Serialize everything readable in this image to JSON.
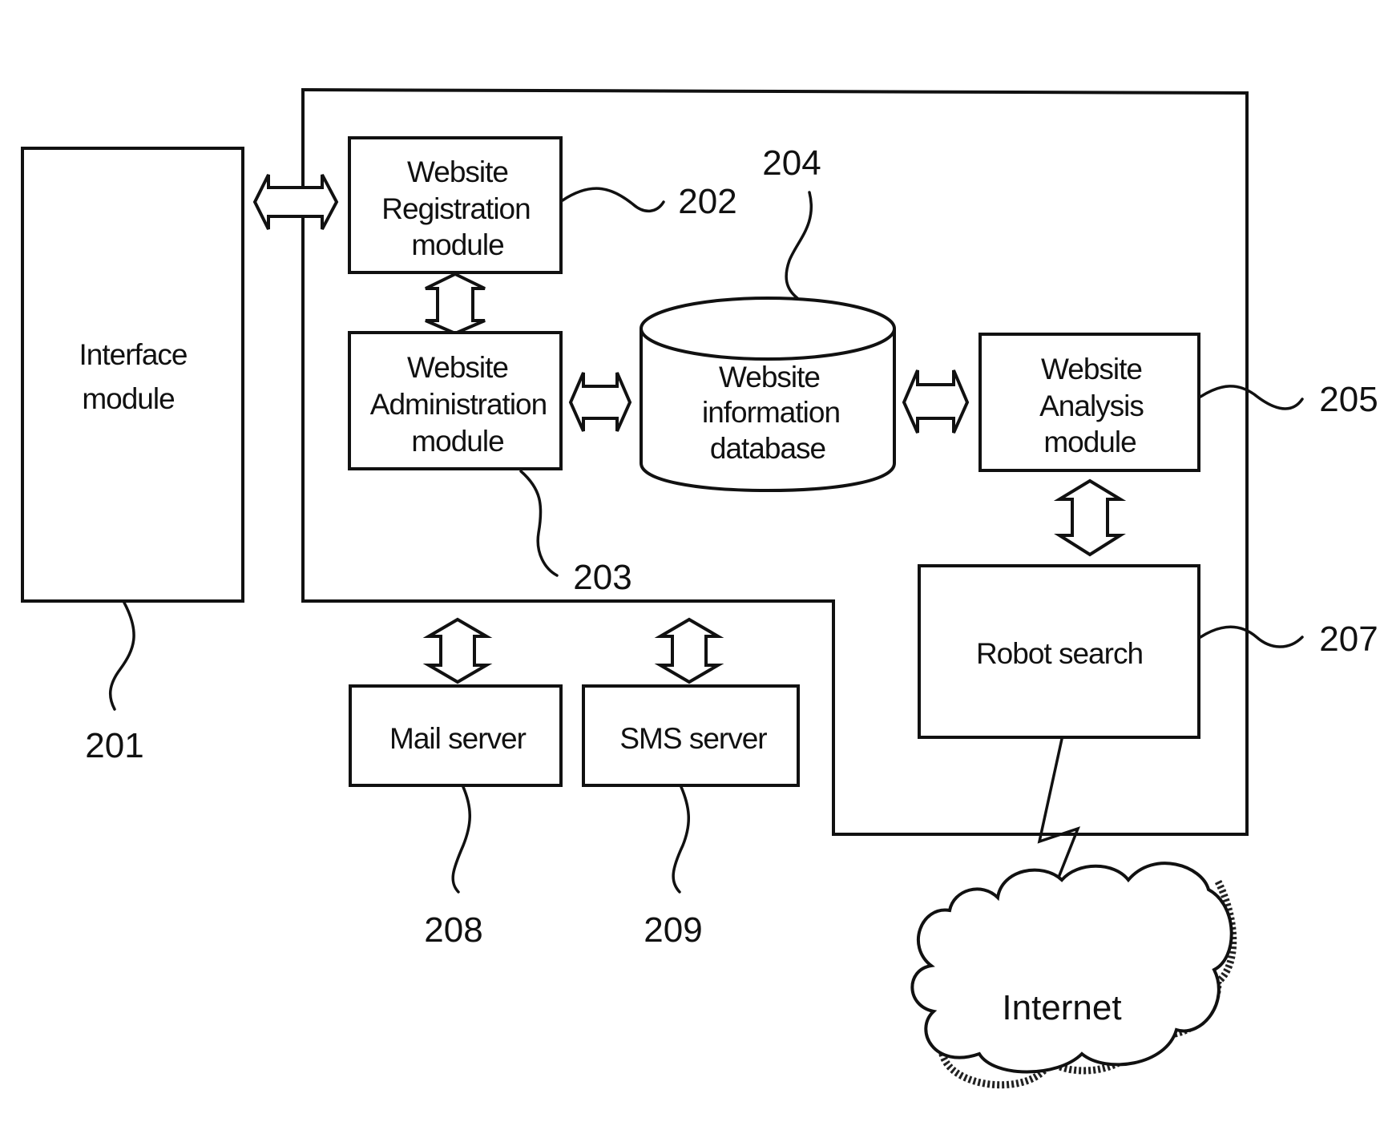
{
  "figure": {
    "nodes": {
      "interface": {
        "lines": [
          "Interface",
          "module"
        ],
        "ref": "201"
      },
      "registration": {
        "lines": [
          "Website",
          "Registration",
          "module"
        ],
        "ref": "202"
      },
      "administration": {
        "lines": [
          "Website",
          "Administration",
          "module"
        ],
        "ref": "203"
      },
      "database": {
        "lines": [
          "Website",
          "information",
          "database"
        ],
        "ref": "204"
      },
      "analysis": {
        "lines": [
          "Website",
          "Analysis",
          "module"
        ],
        "ref": "205"
      },
      "robot": {
        "lines": [
          "Robot search"
        ],
        "ref": "207"
      },
      "mail": {
        "lines": [
          "Mail server"
        ],
        "ref": "208"
      },
      "sms": {
        "lines": [
          "SMS server"
        ],
        "ref": "209"
      },
      "internet": {
        "lines": [
          "Internet"
        ]
      }
    },
    "connections": [
      {
        "from": "interface",
        "to": "registration",
        "type": "bidirectional"
      },
      {
        "from": "registration",
        "to": "administration",
        "type": "bidirectional"
      },
      {
        "from": "administration",
        "to": "database",
        "type": "bidirectional"
      },
      {
        "from": "database",
        "to": "analysis",
        "type": "bidirectional"
      },
      {
        "from": "analysis",
        "to": "robot",
        "type": "bidirectional"
      },
      {
        "from": "system",
        "to": "mail",
        "type": "bidirectional"
      },
      {
        "from": "system",
        "to": "sms",
        "type": "bidirectional"
      },
      {
        "from": "robot",
        "to": "internet",
        "type": "network-link"
      }
    ]
  }
}
